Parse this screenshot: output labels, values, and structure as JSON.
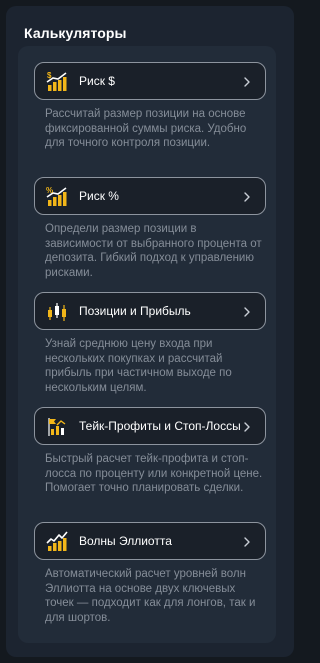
{
  "panel": {
    "title": "Калькуляторы"
  },
  "calculators": [
    {
      "label": "Риск $",
      "icon": "chart-dollar-icon",
      "description": "Рассчитай размер позиции на основе фиксированной суммы риска. Удобно для точного контроля позиции."
    },
    {
      "label": "Риск %",
      "icon": "chart-percent-icon",
      "description": "Определи размер позиции в зависимости от выбранного процента от депозита. Гибкий подход к управлению рисками."
    },
    {
      "label": "Позиции и Прибыль",
      "icon": "candlestick-icon",
      "description": "Узнай среднюю цену входа при нескольких покупках и рассчитай прибыль при частичном выходе по нескольким целям."
    },
    {
      "label": "Тейк-Профиты и Стоп-Лоссы",
      "icon": "take-profit-stop-loss-icon",
      "description": "Быстрый расчет тейк-профита и стоп-лосса по проценту или конкретной цене. Помогает точно планировать сделки."
    },
    {
      "label": "Волны Эллиотта",
      "icon": "elliott-waves-icon",
      "description": "Автоматический расчет уровней волн Эллиотта на основе двух ключевых точек — подходит как для лонгов, так и для шортов."
    }
  ],
  "colors": {
    "background": "#14191f",
    "panel": "#1c2430",
    "inner_panel": "#222c39",
    "button": "#1a2029",
    "button_border": "#8d949e",
    "accent_gold": "#f2b619",
    "text_primary": "#ffffff",
    "text_secondary": "#858d98"
  }
}
